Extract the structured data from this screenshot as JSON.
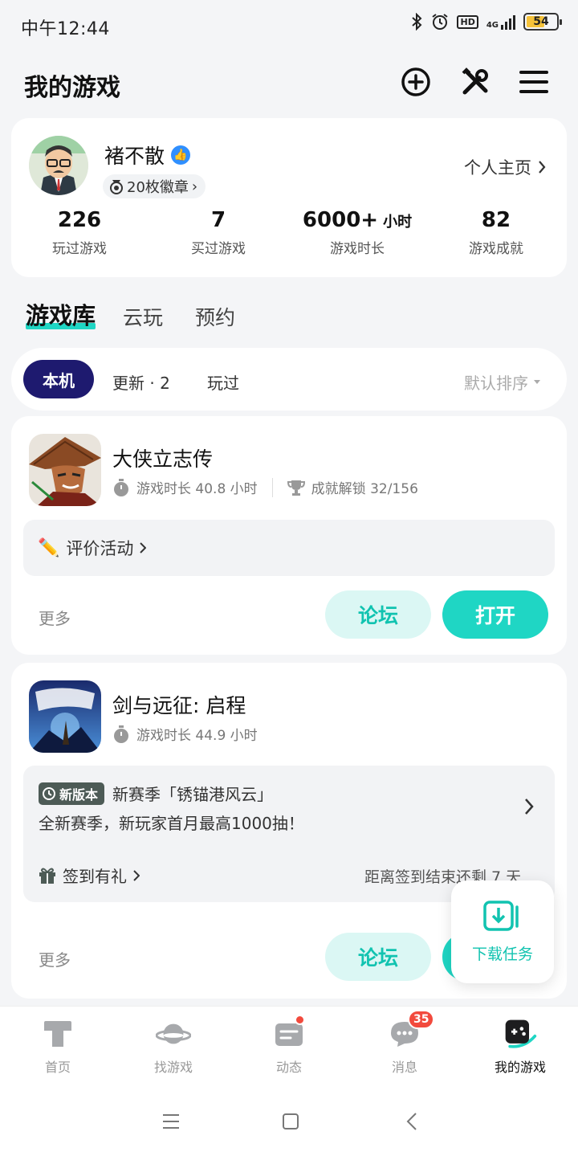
{
  "status_bar": {
    "time": "中午12:44",
    "network": "4G",
    "hd": "HD",
    "battery": "54"
  },
  "header": {
    "title": "我的游戏",
    "icons": [
      "add-circle-icon",
      "tools-icon",
      "menu-icon"
    ]
  },
  "profile": {
    "username": "褚不散",
    "badges": "20枚徽章",
    "homepage_label": "个人主页",
    "stats": [
      {
        "value": "226",
        "unit": "",
        "label": "玩过游戏"
      },
      {
        "value": "7",
        "unit": "",
        "label": "买过游戏"
      },
      {
        "value": "6000+",
        "unit": "小时",
        "label": "游戏时长"
      },
      {
        "value": "82",
        "unit": "",
        "label": "游戏成就"
      }
    ]
  },
  "main_tabs": [
    {
      "label": "游戏库",
      "active": true
    },
    {
      "label": "云玩",
      "active": false
    },
    {
      "label": "预约",
      "active": false
    }
  ],
  "filters": {
    "items": [
      "本机",
      "更新 · 2",
      "玩过"
    ],
    "active": "本机",
    "sort": "默认排序"
  },
  "games": [
    {
      "name": "大侠立志传",
      "playtime": "游戏时长 40.8 小时",
      "achievements": "成就解锁 32/156",
      "promo": "评价活动",
      "more": "更多",
      "forum": "论坛",
      "open": "打开"
    },
    {
      "name": "剑与远征: 启程",
      "playtime": "游戏时长 44.9 小时",
      "version_tag": "新版本",
      "version_title": "新赛季「锈锚港风云」",
      "version_desc": "全新赛季，新玩家首月最高1000抽！",
      "signin": "签到有礼",
      "signin_countdown": "距离签到结束还剩 7 天",
      "more": "更多",
      "forum": "论坛"
    }
  ],
  "float_download": {
    "label": "下载任务"
  },
  "bottom_nav": [
    {
      "label": "首页",
      "icon": "home-icon"
    },
    {
      "label": "找游戏",
      "icon": "planet-icon"
    },
    {
      "label": "动态",
      "icon": "feed-icon",
      "dot": true
    },
    {
      "label": "消息",
      "icon": "message-icon",
      "badge": "35"
    },
    {
      "label": "我的游戏",
      "icon": "gamepad-icon",
      "active": true
    }
  ]
}
